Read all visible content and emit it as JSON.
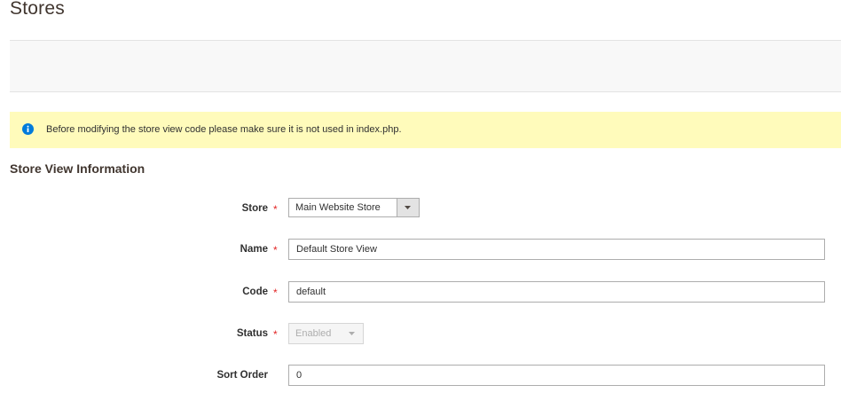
{
  "header": {
    "title": "Stores"
  },
  "notice": {
    "text": "Before modifying the store view code please make sure it is not used in index.php."
  },
  "section": {
    "title": "Store View Information"
  },
  "form": {
    "store": {
      "label": "Store",
      "required": "*",
      "value": "Main Website Store"
    },
    "name": {
      "label": "Name",
      "required": "*",
      "value": "Default Store View"
    },
    "code": {
      "label": "Code",
      "required": "*",
      "value": "default"
    },
    "status": {
      "label": "Status",
      "required": "*",
      "value": "Enabled",
      "disabled": true
    },
    "sort_order": {
      "label": "Sort Order",
      "value": "0"
    }
  },
  "colors": {
    "notice_background": "#fffbbb",
    "info_icon": "#007bdb",
    "required_asterisk": "#e22626"
  },
  "icons": {
    "notice": "info-icon",
    "select_toggle": "chevron-down-icon"
  }
}
